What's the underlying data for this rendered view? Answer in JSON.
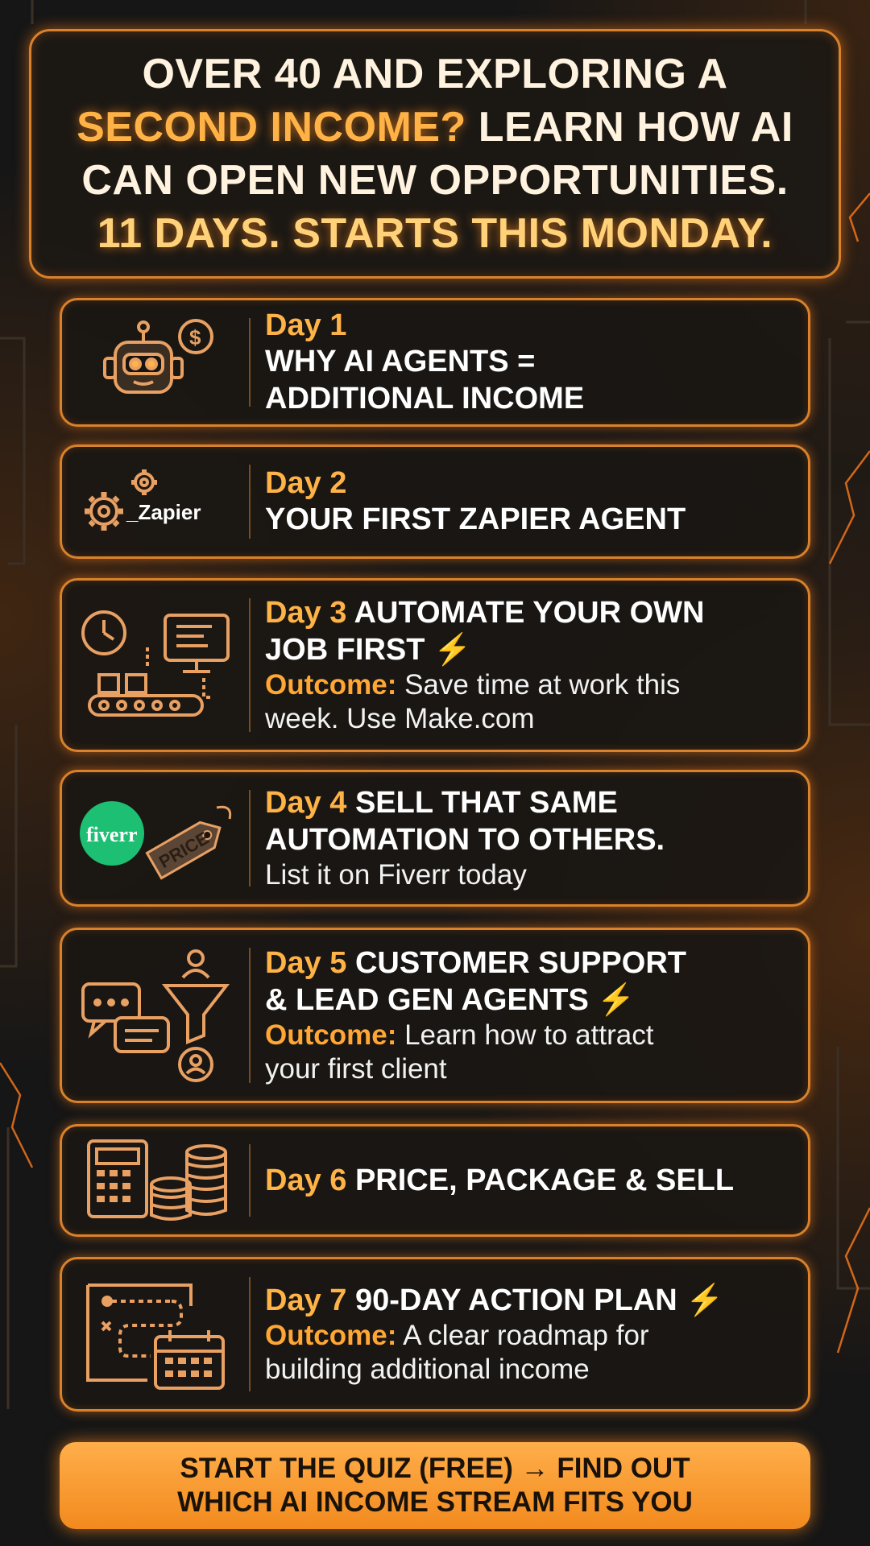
{
  "headline": {
    "line1": "OVER 40 AND EXPLORING A",
    "line2a": "SECOND INCOME?",
    "line2b": " LEARN HOW AI",
    "line3": "CAN OPEN NEW OPPORTUNITIES.",
    "line4": "11 DAYS. STARTS THIS MONDAY."
  },
  "days": [
    {
      "day": "Day 1",
      "title1": "WHY AI AGENTS =",
      "title2": "ADDITIONAL INCOME",
      "icon": "robot-dollar-icon"
    },
    {
      "day": "Day 2",
      "title1": "YOUR FIRST ZAPIER AGENT",
      "icon": "zapier-gears-icon",
      "logo_text": "_Zapier"
    },
    {
      "day": "Day 3",
      "title_inline": " AUTOMATE YOUR OWN",
      "title2": "JOB FIRST",
      "outcome_label": "Outcome:",
      "outcome1": " Save time at work this",
      "outcome2": "week. Use Make.com",
      "icon": "workflow-automation-icon"
    },
    {
      "day": "Day 4",
      "title_inline": " SELL THAT SAME",
      "title2": "AUTOMATION TO OTHERS.",
      "sub": "List it on Fiverr today",
      "icon": "fiverr-price-tag-icon",
      "logo_text": "fiverr",
      "tag_text": "PRICE"
    },
    {
      "day": "Day 5",
      "title_inline": " CUSTOMER SUPPORT",
      "title2": "& LEAD GEN AGENTS",
      "outcome_label": "Outcome:",
      "outcome1": " Learn how to attract",
      "outcome2": "your first client",
      "icon": "chat-funnel-icon"
    },
    {
      "day": "Day 6",
      "title_inline": " PRICE, PACKAGE & SELL",
      "icon": "calculator-coins-icon"
    },
    {
      "day": "Day 7",
      "title_inline": " 90-DAY ACTION PLAN",
      "outcome_label": "Outcome:",
      "outcome1": " A clear roadmap for",
      "outcome2": "building additional income",
      "icon": "roadmap-calendar-icon"
    }
  ],
  "bolt": "⚡",
  "cta": {
    "line1": "START THE QUIZ (FREE) → FIND OUT",
    "line2": "WHICH AI INCOME STREAM FITS YOU"
  },
  "colors": {
    "accent": "#ffb347",
    "border": "#d9822b",
    "background": "#161616",
    "cta": "#f28a1e"
  }
}
